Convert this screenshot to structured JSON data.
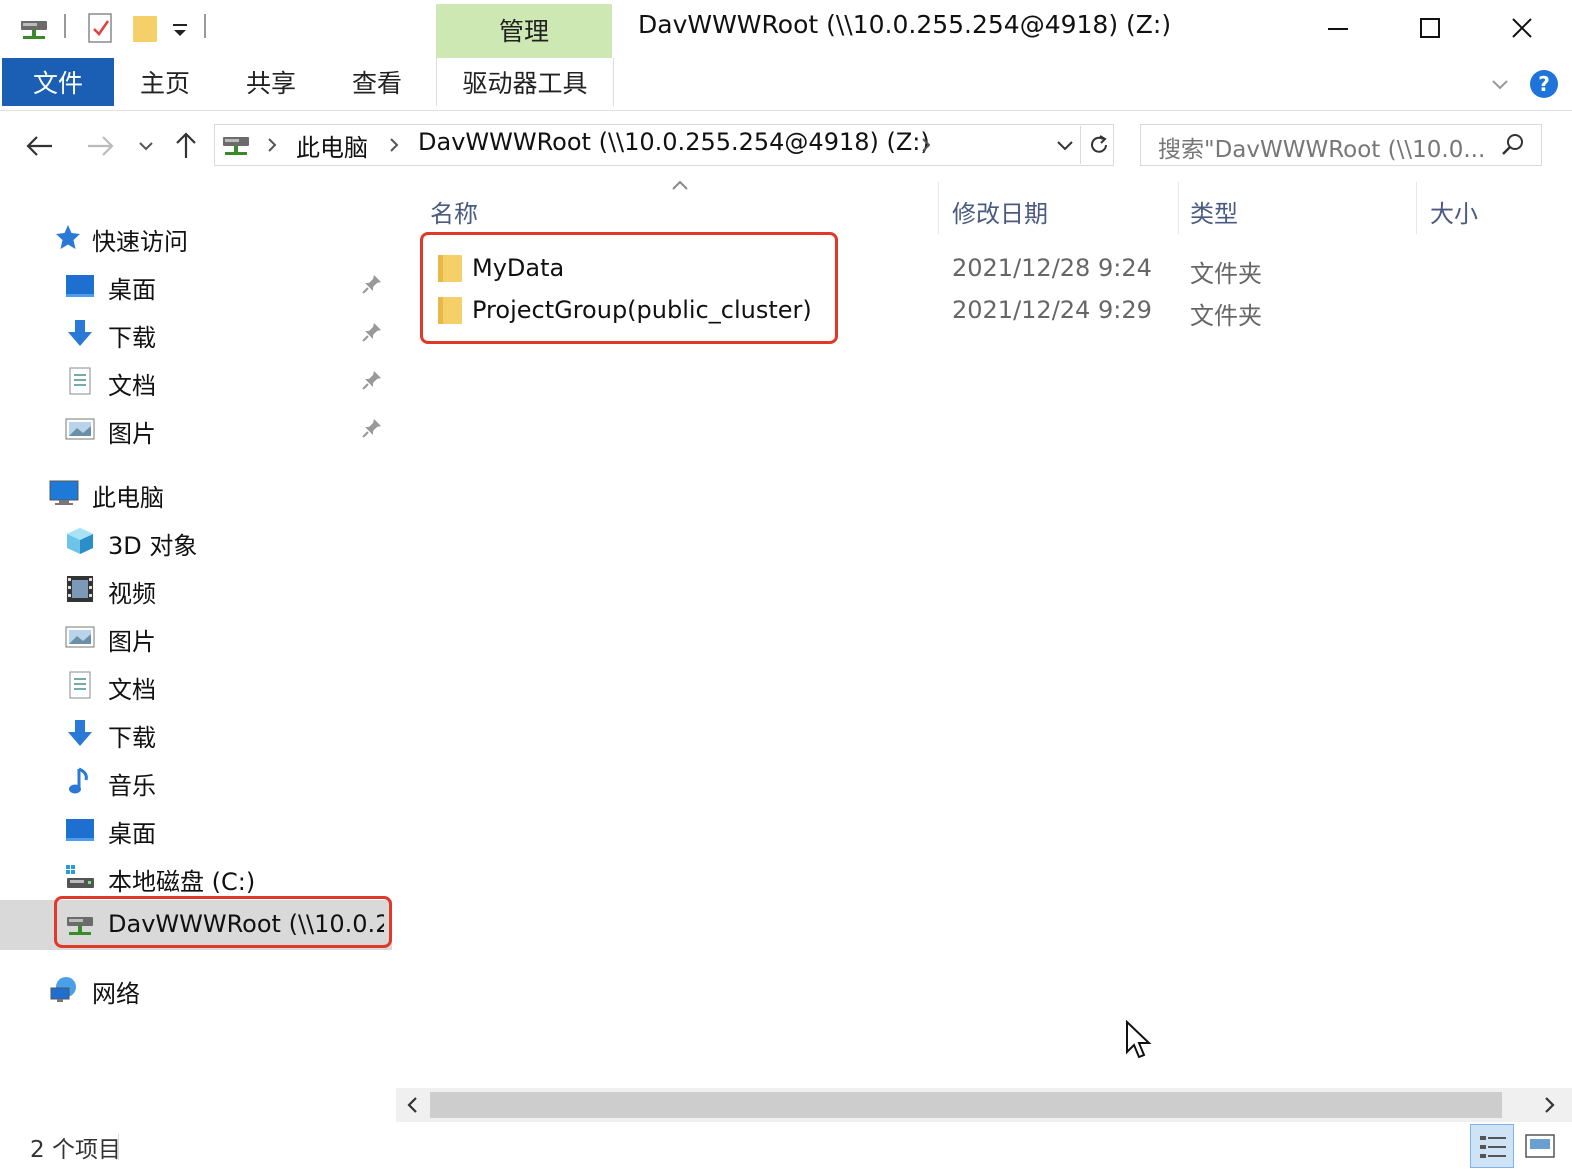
{
  "window": {
    "title": "DavWWWRoot (\\\\10.0.255.254@4918) (Z:)",
    "context_tab_label": "管理"
  },
  "ribbon": {
    "tabs": [
      {
        "label": "文件"
      },
      {
        "label": "主页"
      },
      {
        "label": "共享"
      },
      {
        "label": "查看"
      },
      {
        "label": "驱动器工具"
      }
    ]
  },
  "address": {
    "crumbs": [
      "此电脑",
      "DavWWWRoot (\\\\10.0.255.254@4918) (Z:)"
    ],
    "search_placeholder": "搜索\"DavWWWRoot (\\\\10.0..."
  },
  "sidebar": {
    "quick_access": "快速访问",
    "quick_items": [
      {
        "label": "桌面"
      },
      {
        "label": "下载"
      },
      {
        "label": "文档"
      },
      {
        "label": "图片"
      }
    ],
    "this_pc": "此电脑",
    "pc_items": [
      {
        "label": "3D 对象"
      },
      {
        "label": "视频"
      },
      {
        "label": "图片"
      },
      {
        "label": "文档"
      },
      {
        "label": "下载"
      },
      {
        "label": "音乐"
      },
      {
        "label": "桌面"
      },
      {
        "label": "本地磁盘 (C:)"
      },
      {
        "label": "DavWWWRoot (\\\\10.0.2"
      }
    ],
    "network": "网络"
  },
  "columns": {
    "name": "名称",
    "date": "修改日期",
    "type": "类型",
    "size": "大小"
  },
  "files": [
    {
      "name": "MyData",
      "date": "2021/12/28 9:24",
      "type": "文件夹"
    },
    {
      "name": "ProjectGroup(public_cluster)",
      "date": "2021/12/24 9:29",
      "type": "文件夹"
    }
  ],
  "status": {
    "count": "2 个项目"
  },
  "colors": {
    "file_tab": "#1a5fb4",
    "context_tab": "#cde8b2",
    "highlight": "#e0392a",
    "folder": "#f5cf68"
  }
}
